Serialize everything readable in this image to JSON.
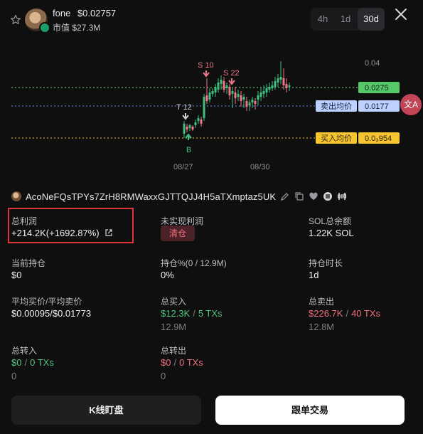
{
  "header": {
    "token_name": "fone",
    "price": "$0.02757",
    "market_cap": "市值 $27.3M",
    "timeframes": [
      {
        "label": "4h",
        "active": false
      },
      {
        "label": "1d",
        "active": false
      },
      {
        "label": "30d",
        "active": true
      }
    ]
  },
  "chart": {
    "axis_top_label": "0.04",
    "price_tag": "0.0275",
    "sell_avg": {
      "label": "卖出均价",
      "value": "0.0177"
    },
    "buy_avg": {
      "label": "买入均价",
      "value": "0.0₃954"
    },
    "x_labels": [
      "08/27",
      "08/30"
    ],
    "markers": {
      "t12": "T 12",
      "s10": "S 10",
      "s22": "S 22",
      "b": "B"
    },
    "colors": {
      "up": "#3fbf7f",
      "down": "#f0768a",
      "price_line": "#7bd87b",
      "sell_line": "#6e8ef0",
      "buy_line": "#f4c23a"
    }
  },
  "translate_fab": "文A",
  "wallet": {
    "address": "AcoNeFQsTPYs7ZrH8RMWaxxGJTTQJJ4H5aTXmptaz5UK"
  },
  "stats": {
    "total_profit": {
      "label": "总利润",
      "value": "+214.2K(+1692.87%)"
    },
    "unrealized": {
      "label": "未实现利润",
      "button": "清仓"
    },
    "sol_balance": {
      "label": "SOL总余额",
      "value": "1.22K SOL"
    },
    "current_position": {
      "label": "当前持仓",
      "value": "$0"
    },
    "position_pct": {
      "label": "持仓%(0 / 12.9M)",
      "value": "0%"
    },
    "hold_duration": {
      "label": "持仓时长",
      "value": "1d"
    },
    "avg_price": {
      "label": "平均买价/平均卖价",
      "value": "$0.00095/$0.01773"
    },
    "total_buy": {
      "label": "总买入",
      "amount": "$12.3K",
      "txs": "5 TXs",
      "sub": "12.9M"
    },
    "total_sell": {
      "label": "总卖出",
      "amount": "$226.7K",
      "txs": "40 TXs",
      "sub": "12.8M"
    },
    "transfer_in": {
      "label": "总转入",
      "amount": "$0",
      "txs": "0 TXs",
      "sub": "0"
    },
    "transfer_out": {
      "label": "总转出",
      "amount": "$0",
      "txs": "0 TXs",
      "sub": "0"
    }
  },
  "buttons": {
    "kline": "K线盯盘",
    "copy_trade": "跟单交易"
  }
}
